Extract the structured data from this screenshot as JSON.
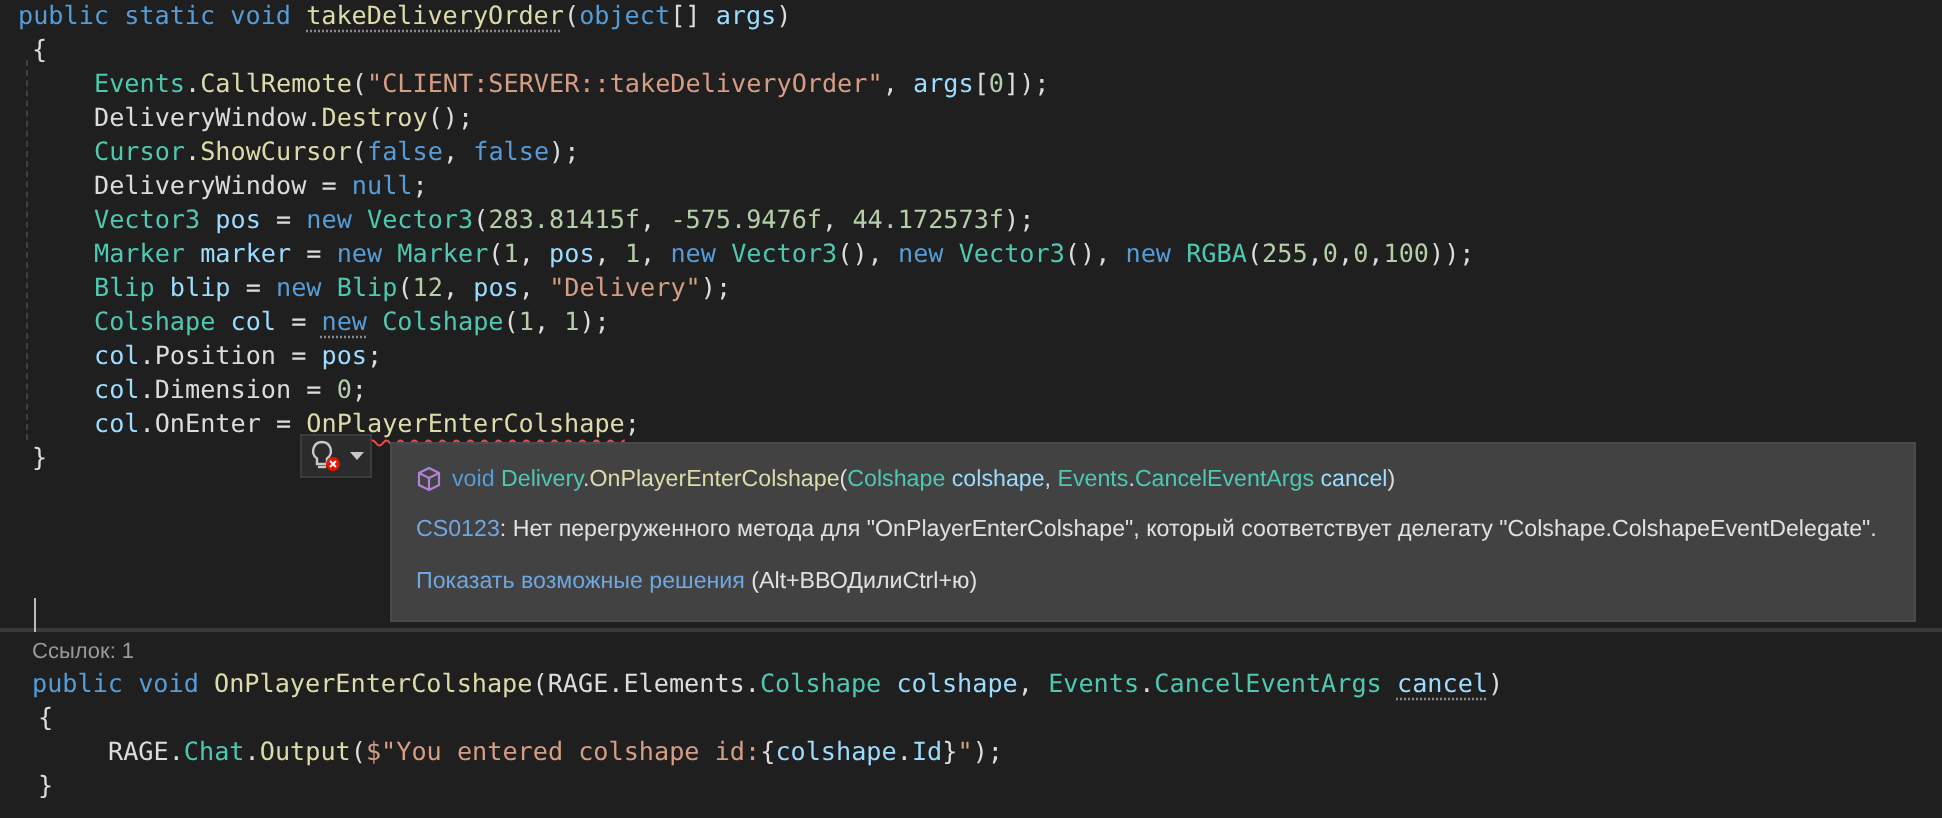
{
  "editor": {
    "method_block": {
      "signature": [
        {
          "kind": "kw",
          "text": "public static void "
        },
        {
          "kind": "method",
          "text": "takeDeliveryOrder",
          "hint": true
        },
        {
          "kind": "plain",
          "text": "("
        },
        {
          "kind": "kw",
          "text": "object"
        },
        {
          "kind": "plain",
          "text": "[] "
        },
        {
          "kind": "var",
          "text": "args"
        },
        {
          "kind": "plain",
          "text": ")"
        }
      ],
      "open": "{",
      "body": [
        [
          {
            "kind": "type",
            "text": "Events"
          },
          {
            "kind": "plain",
            "text": "."
          },
          {
            "kind": "method",
            "text": "CallRemote"
          },
          {
            "kind": "plain",
            "text": "("
          },
          {
            "kind": "str",
            "text": "\"CLIENT:SERVER::takeDeliveryOrder\""
          },
          {
            "kind": "plain",
            "text": ", "
          },
          {
            "kind": "var",
            "text": "args"
          },
          {
            "kind": "plain",
            "text": "["
          },
          {
            "kind": "num",
            "text": "0"
          },
          {
            "kind": "plain",
            "text": "]);"
          }
        ],
        [
          {
            "kind": "plain",
            "text": "DeliveryWindow."
          },
          {
            "kind": "method",
            "text": "Destroy"
          },
          {
            "kind": "plain",
            "text": "();"
          }
        ],
        [
          {
            "kind": "type",
            "text": "Cursor"
          },
          {
            "kind": "plain",
            "text": "."
          },
          {
            "kind": "method",
            "text": "ShowCursor"
          },
          {
            "kind": "plain",
            "text": "("
          },
          {
            "kind": "kw",
            "text": "false"
          },
          {
            "kind": "plain",
            "text": ", "
          },
          {
            "kind": "kw",
            "text": "false"
          },
          {
            "kind": "plain",
            "text": ");"
          }
        ],
        [
          {
            "kind": "plain",
            "text": "DeliveryWindow = "
          },
          {
            "kind": "kw",
            "text": "null"
          },
          {
            "kind": "plain",
            "text": ";"
          }
        ],
        [
          {
            "kind": "type",
            "text": "Vector3 "
          },
          {
            "kind": "var",
            "text": "pos"
          },
          {
            "kind": "plain",
            "text": " = "
          },
          {
            "kind": "kw",
            "text": "new "
          },
          {
            "kind": "type",
            "text": "Vector3"
          },
          {
            "kind": "plain",
            "text": "("
          },
          {
            "kind": "num",
            "text": "283.81415f"
          },
          {
            "kind": "plain",
            "text": ", "
          },
          {
            "kind": "num",
            "text": "-575.9476f"
          },
          {
            "kind": "plain",
            "text": ", "
          },
          {
            "kind": "num",
            "text": "44.172573f"
          },
          {
            "kind": "plain",
            "text": ");"
          }
        ],
        [
          {
            "kind": "type",
            "text": "Marker "
          },
          {
            "kind": "var",
            "text": "marker"
          },
          {
            "kind": "plain",
            "text": " = "
          },
          {
            "kind": "kw",
            "text": "new "
          },
          {
            "kind": "type",
            "text": "Marker"
          },
          {
            "kind": "plain",
            "text": "("
          },
          {
            "kind": "num",
            "text": "1"
          },
          {
            "kind": "plain",
            "text": ", "
          },
          {
            "kind": "var",
            "text": "pos"
          },
          {
            "kind": "plain",
            "text": ", "
          },
          {
            "kind": "num",
            "text": "1"
          },
          {
            "kind": "plain",
            "text": ", "
          },
          {
            "kind": "kw",
            "text": "new "
          },
          {
            "kind": "type",
            "text": "Vector3"
          },
          {
            "kind": "plain",
            "text": "(), "
          },
          {
            "kind": "kw",
            "text": "new "
          },
          {
            "kind": "type",
            "text": "Vector3"
          },
          {
            "kind": "plain",
            "text": "(), "
          },
          {
            "kind": "kw",
            "text": "new "
          },
          {
            "kind": "type",
            "text": "RGBA"
          },
          {
            "kind": "plain",
            "text": "("
          },
          {
            "kind": "num",
            "text": "255"
          },
          {
            "kind": "plain",
            "text": ","
          },
          {
            "kind": "num",
            "text": "0"
          },
          {
            "kind": "plain",
            "text": ","
          },
          {
            "kind": "num",
            "text": "0"
          },
          {
            "kind": "plain",
            "text": ","
          },
          {
            "kind": "num",
            "text": "100"
          },
          {
            "kind": "plain",
            "text": "));"
          }
        ],
        [
          {
            "kind": "type",
            "text": "Blip "
          },
          {
            "kind": "var",
            "text": "blip"
          },
          {
            "kind": "plain",
            "text": " = "
          },
          {
            "kind": "kw",
            "text": "new "
          },
          {
            "kind": "type",
            "text": "Blip"
          },
          {
            "kind": "plain",
            "text": "("
          },
          {
            "kind": "num",
            "text": "12"
          },
          {
            "kind": "plain",
            "text": ", "
          },
          {
            "kind": "var",
            "text": "pos"
          },
          {
            "kind": "plain",
            "text": ", "
          },
          {
            "kind": "str",
            "text": "\"Delivery\""
          },
          {
            "kind": "plain",
            "text": ");"
          }
        ],
        [
          {
            "kind": "type",
            "text": "Colshape "
          },
          {
            "kind": "var",
            "text": "col"
          },
          {
            "kind": "plain",
            "text": " = "
          },
          {
            "kind": "kw",
            "text": "new",
            "hint": true
          },
          {
            "kind": "type",
            "text": " Colshape"
          },
          {
            "kind": "plain",
            "text": "("
          },
          {
            "kind": "num",
            "text": "1"
          },
          {
            "kind": "plain",
            "text": ", "
          },
          {
            "kind": "num",
            "text": "1"
          },
          {
            "kind": "plain",
            "text": ");"
          }
        ],
        [
          {
            "kind": "var",
            "text": "col"
          },
          {
            "kind": "plain",
            "text": ".Position = "
          },
          {
            "kind": "var",
            "text": "pos"
          },
          {
            "kind": "plain",
            "text": ";"
          }
        ],
        [
          {
            "kind": "var",
            "text": "col"
          },
          {
            "kind": "plain",
            "text": ".Dimension = "
          },
          {
            "kind": "num",
            "text": "0"
          },
          {
            "kind": "plain",
            "text": ";"
          }
        ],
        [
          {
            "kind": "var",
            "text": "col"
          },
          {
            "kind": "plain",
            "text": ".OnEnter = "
          },
          {
            "kind": "method",
            "text": "OnPlayerEnterColshape",
            "error": true
          },
          {
            "kind": "plain",
            "text": ";"
          }
        ]
      ],
      "close": "}"
    },
    "quick_info": {
      "signature": [
        {
          "kind": "kw",
          "text": "void "
        },
        {
          "kind": "type",
          "text": "Delivery"
        },
        {
          "kind": "plain",
          "text": "."
        },
        {
          "kind": "method",
          "text": "OnPlayerEnterColshape"
        },
        {
          "kind": "plain",
          "text": "("
        },
        {
          "kind": "type",
          "text": "Colshape"
        },
        {
          "kind": "var",
          "text": " colshape"
        },
        {
          "kind": "plain",
          "text": ", "
        },
        {
          "kind": "type",
          "text": "Events"
        },
        {
          "kind": "plain",
          "text": "."
        },
        {
          "kind": "type",
          "text": "CancelEventArgs"
        },
        {
          "kind": "var",
          "text": " cancel"
        },
        {
          "kind": "plain",
          "text": ")"
        }
      ],
      "error_code": "CS0123",
      "error_message": ": Нет перегруженного метода для \"OnPlayerEnterColshape\", который соответствует делегату \"Colshape.ColshapeEventDelegate\".",
      "fix_link": "Показать возможные решения",
      "fix_shortcut": " (Alt+ВВОДилиCtrl+ю)"
    },
    "handler_block": {
      "references": "Ссылок: 1",
      "signature": [
        {
          "kind": "kw",
          "text": "public void "
        },
        {
          "kind": "method",
          "text": "OnPlayerEnterColshape"
        },
        {
          "kind": "plain",
          "text": "(RAGE.Elements."
        },
        {
          "kind": "type",
          "text": "Colshape "
        },
        {
          "kind": "var",
          "text": "colshape"
        },
        {
          "kind": "plain",
          "text": ", "
        },
        {
          "kind": "type",
          "text": "Events"
        },
        {
          "kind": "plain",
          "text": "."
        },
        {
          "kind": "type",
          "text": "CancelEventArgs "
        },
        {
          "kind": "var",
          "text": "cancel",
          "hint": true
        },
        {
          "kind": "plain",
          "text": ")"
        }
      ],
      "open": "{",
      "body": [
        [
          {
            "kind": "plain",
            "text": "RAGE."
          },
          {
            "kind": "type",
            "text": "Chat"
          },
          {
            "kind": "plain",
            "text": "."
          },
          {
            "kind": "method",
            "text": "Output"
          },
          {
            "kind": "plain",
            "text": "("
          },
          {
            "kind": "str",
            "text": "$\"You entered colshape id:"
          },
          {
            "kind": "plain",
            "text": "{"
          },
          {
            "kind": "var",
            "text": "colshape"
          },
          {
            "kind": "plain",
            "text": "."
          },
          {
            "kind": "var",
            "text": "Id"
          },
          {
            "kind": "plain",
            "text": "}"
          },
          {
            "kind": "str",
            "text": "\""
          },
          {
            "kind": "plain",
            "text": ");"
          }
        ]
      ],
      "close": "}"
    }
  }
}
